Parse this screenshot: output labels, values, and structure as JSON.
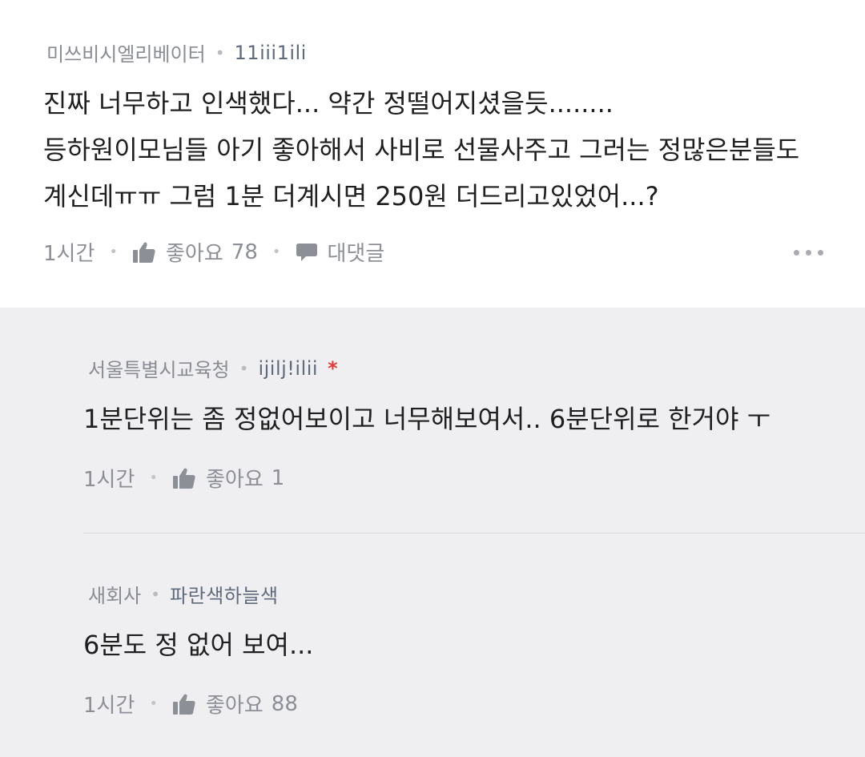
{
  "main_comment": {
    "author": "미쓰비시엘리베이터",
    "nickname": "11iii1ili",
    "lines": [
      "진짜 너무하고 인색했다... 약간 정떨어지셨을듯........",
      "등하원이모님들 아기 좋아해서 사비로 선물사주고 그러는 정많은분들도",
      "계신데ㅠㅠ 그럼 1분 더계시면 250원 더드리고있었어...?"
    ],
    "time": "1시간",
    "like_label": "좋아요",
    "like_count": "78",
    "reply_label": "대댓글"
  },
  "replies": [
    {
      "author": "서울특별시교육청",
      "nickname": "ijilj!ilii",
      "badge": "*",
      "text": "1분단위는 좀 정없어보이고 너무해보여서.. 6분단위로 한거야 ㅜ",
      "time": "1시간",
      "like_label": "좋아요",
      "like_count": "1"
    },
    {
      "author": "새회사",
      "nickname": "파란색하늘색",
      "text": "6분도 정 없어 보여...",
      "time": "1시간",
      "like_label": "좋아요",
      "like_count": "88"
    }
  ],
  "colors": {
    "reply_bg": "#efeff1",
    "badge": "#e53935",
    "meta": "#8a8c93"
  }
}
